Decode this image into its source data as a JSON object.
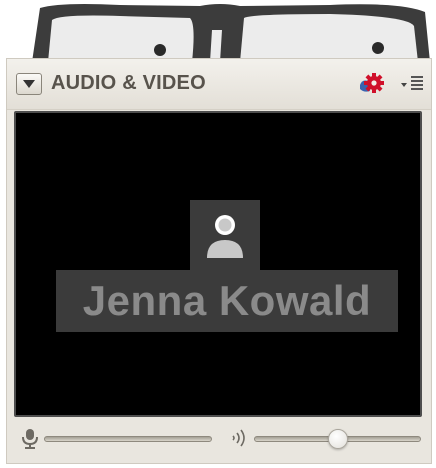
{
  "panel": {
    "title": "AUDIO & VIDEO",
    "collapse_icon": "triangle-down-icon",
    "settings_icon": "gear-icon",
    "menu_icon": "list-menu-icon"
  },
  "video": {
    "participant_name": "Jenna Kowald",
    "avatar_icon": "user-silhouette-icon"
  },
  "controls": {
    "mic_icon": "microphone-icon",
    "speaker_icon": "speaker-icon",
    "mic_volume": 0,
    "speaker_volume": 0.5
  },
  "colors": {
    "panel_bg": "#e9e6df",
    "title_text": "#58534c",
    "video_bg": "#000000",
    "name_text": "#8a8a8a",
    "accent_gear": "#d0102a"
  }
}
